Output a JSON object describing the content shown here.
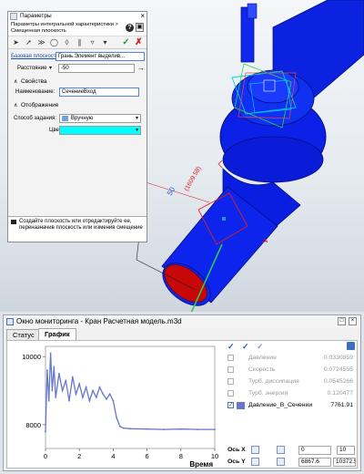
{
  "params_panel": {
    "title": "Параметры",
    "breadcrumb": "Параметры интегральной характеристики > Смещенная плоскость",
    "base_plane_label": "Базовая плоскость",
    "base_plane_value": "Грань.Элемент выделив...",
    "distance_label": "Расстояние",
    "distance_value": "-50",
    "properties_header": "Свойства",
    "name_label": "Наименование:",
    "name_value": "СечениеВход",
    "display_header": "Отображение",
    "method_label": "Способ задания:",
    "method_value": "Вручную",
    "color_label": "Цвет:",
    "color_value": "#00ffff",
    "note": "Создайте плоскость или отредактируйте ее, переназначив плоскость или изменив смещение"
  },
  "viewport": {
    "dim_offset": "50",
    "dim_size": "(1609.58)",
    "model_color": "#0a1fe6",
    "section_color": "#c80808",
    "arrow_color": "#2ec84e"
  },
  "monitor": {
    "title": "Окно мониторинга - Кран Расчетная модель.m3d",
    "tabs": [
      "Статус",
      "График"
    ],
    "active_tab": "График",
    "legend": [
      {
        "name": "Давление",
        "value": "0.0330859",
        "checked": false
      },
      {
        "name": "Скорость",
        "value": "0.0724555",
        "checked": false
      },
      {
        "name": "Турб. диссипация",
        "value": "0.0545266",
        "checked": false
      },
      {
        "name": "Турб. энергия",
        "value": "0.120477",
        "checked": false
      },
      {
        "name": "Давление_В_Сечении",
        "value": "7761.91",
        "checked": true,
        "color": "#6677cc"
      }
    ],
    "axis_x_label": "Ось X",
    "axis_x_min": "0",
    "axis_x_max": "10",
    "axis_y_label": "Ось Y",
    "axis_y_min": "6867.6",
    "axis_y_max": "10372.5"
  },
  "chart_data": {
    "type": "line",
    "xlabel": "Время",
    "ylabel": "",
    "xlim": [
      0,
      10
    ],
    "ylim": [
      7300,
      10300
    ],
    "x_ticks": [
      0,
      2,
      4,
      6,
      8,
      10
    ],
    "y_ticks": [
      8000,
      10000
    ],
    "series": [
      {
        "name": "Давление_В_Сечении",
        "color": "#6677cc",
        "x": [
          0,
          0.1,
          0.2,
          0.3,
          0.4,
          0.5,
          0.6,
          0.8,
          1.0,
          1.2,
          1.4,
          1.6,
          1.8,
          2.0,
          2.2,
          2.4,
          2.6,
          2.8,
          3.0,
          3.2,
          3.4,
          3.6,
          3.8,
          4.0,
          4.2,
          4.4,
          4.6,
          5.0,
          6.0,
          7.0,
          8.0,
          9.0,
          10.0
        ],
        "y": [
          7800,
          9600,
          8700,
          10100,
          9000,
          9700,
          8800,
          9500,
          9000,
          9300,
          8700,
          9400,
          8900,
          9200,
          8800,
          9100,
          8700,
          9000,
          8800,
          9100,
          8900,
          8750,
          8900,
          8700,
          8200,
          7950,
          7900,
          7880,
          7870,
          7860,
          7870,
          7860,
          7860
        ]
      }
    ]
  }
}
